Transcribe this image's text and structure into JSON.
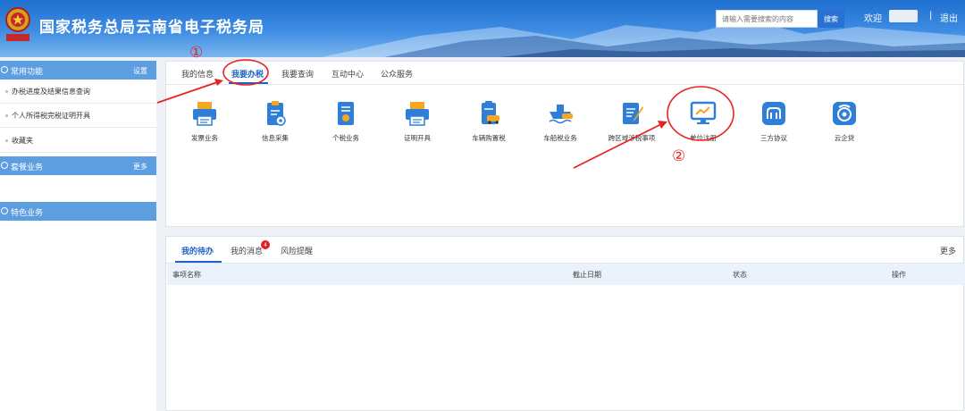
{
  "header": {
    "title": "国家税务总局云南省电子税务局",
    "search_placeholder": "请输入需要搜索的内容",
    "search_button": "搜索",
    "welcome": "欢迎",
    "separator": "|",
    "logout": "退出"
  },
  "sidebar": {
    "section1": {
      "title": "常用功能",
      "action": "设置"
    },
    "items": [
      "办税进度及结果信息查询",
      "个人所得税完税证明开具",
      "收藏夹"
    ],
    "section2": {
      "title": "套餐业务",
      "action": "更多"
    },
    "section3": {
      "title": "特色业务"
    }
  },
  "top_tabs": [
    "我的信息",
    "我要办税",
    "我要查询",
    "互动中心",
    "公众服务"
  ],
  "services": [
    {
      "label": "发票业务",
      "icon": "printer-icon"
    },
    {
      "label": "信息采集",
      "icon": "clipboard-gear-icon"
    },
    {
      "label": "个税业务",
      "icon": "document-badge-icon"
    },
    {
      "label": "证明开具",
      "icon": "printer-icon"
    },
    {
      "label": "车辆购置税",
      "icon": "car-tax-icon"
    },
    {
      "label": "车船税业务",
      "icon": "ship-tax-icon"
    },
    {
      "label": "跨区域涉税事项",
      "icon": "document-pen-icon"
    },
    {
      "label": "单位注册",
      "icon": "monitor-chart-icon"
    },
    {
      "label": "三方协议",
      "icon": "agreement-icon"
    },
    {
      "label": "云企贷",
      "icon": "cloud-loan-icon"
    }
  ],
  "bottom_tabs": [
    "我的待办",
    "我的消息",
    "风险提醒"
  ],
  "message_badge": "4",
  "more_link": "更多",
  "table_headers": [
    "事项名称",
    "截止日期",
    "状态",
    "操作"
  ],
  "annotations": {
    "step1": "①",
    "step2": "②"
  },
  "colors": {
    "accent": "#1d63c8",
    "annotation": "#e42424",
    "sidebar_head": "#5c9ee0",
    "icon_blue": "#2f7fd8",
    "icon_orange": "#f5a623"
  }
}
